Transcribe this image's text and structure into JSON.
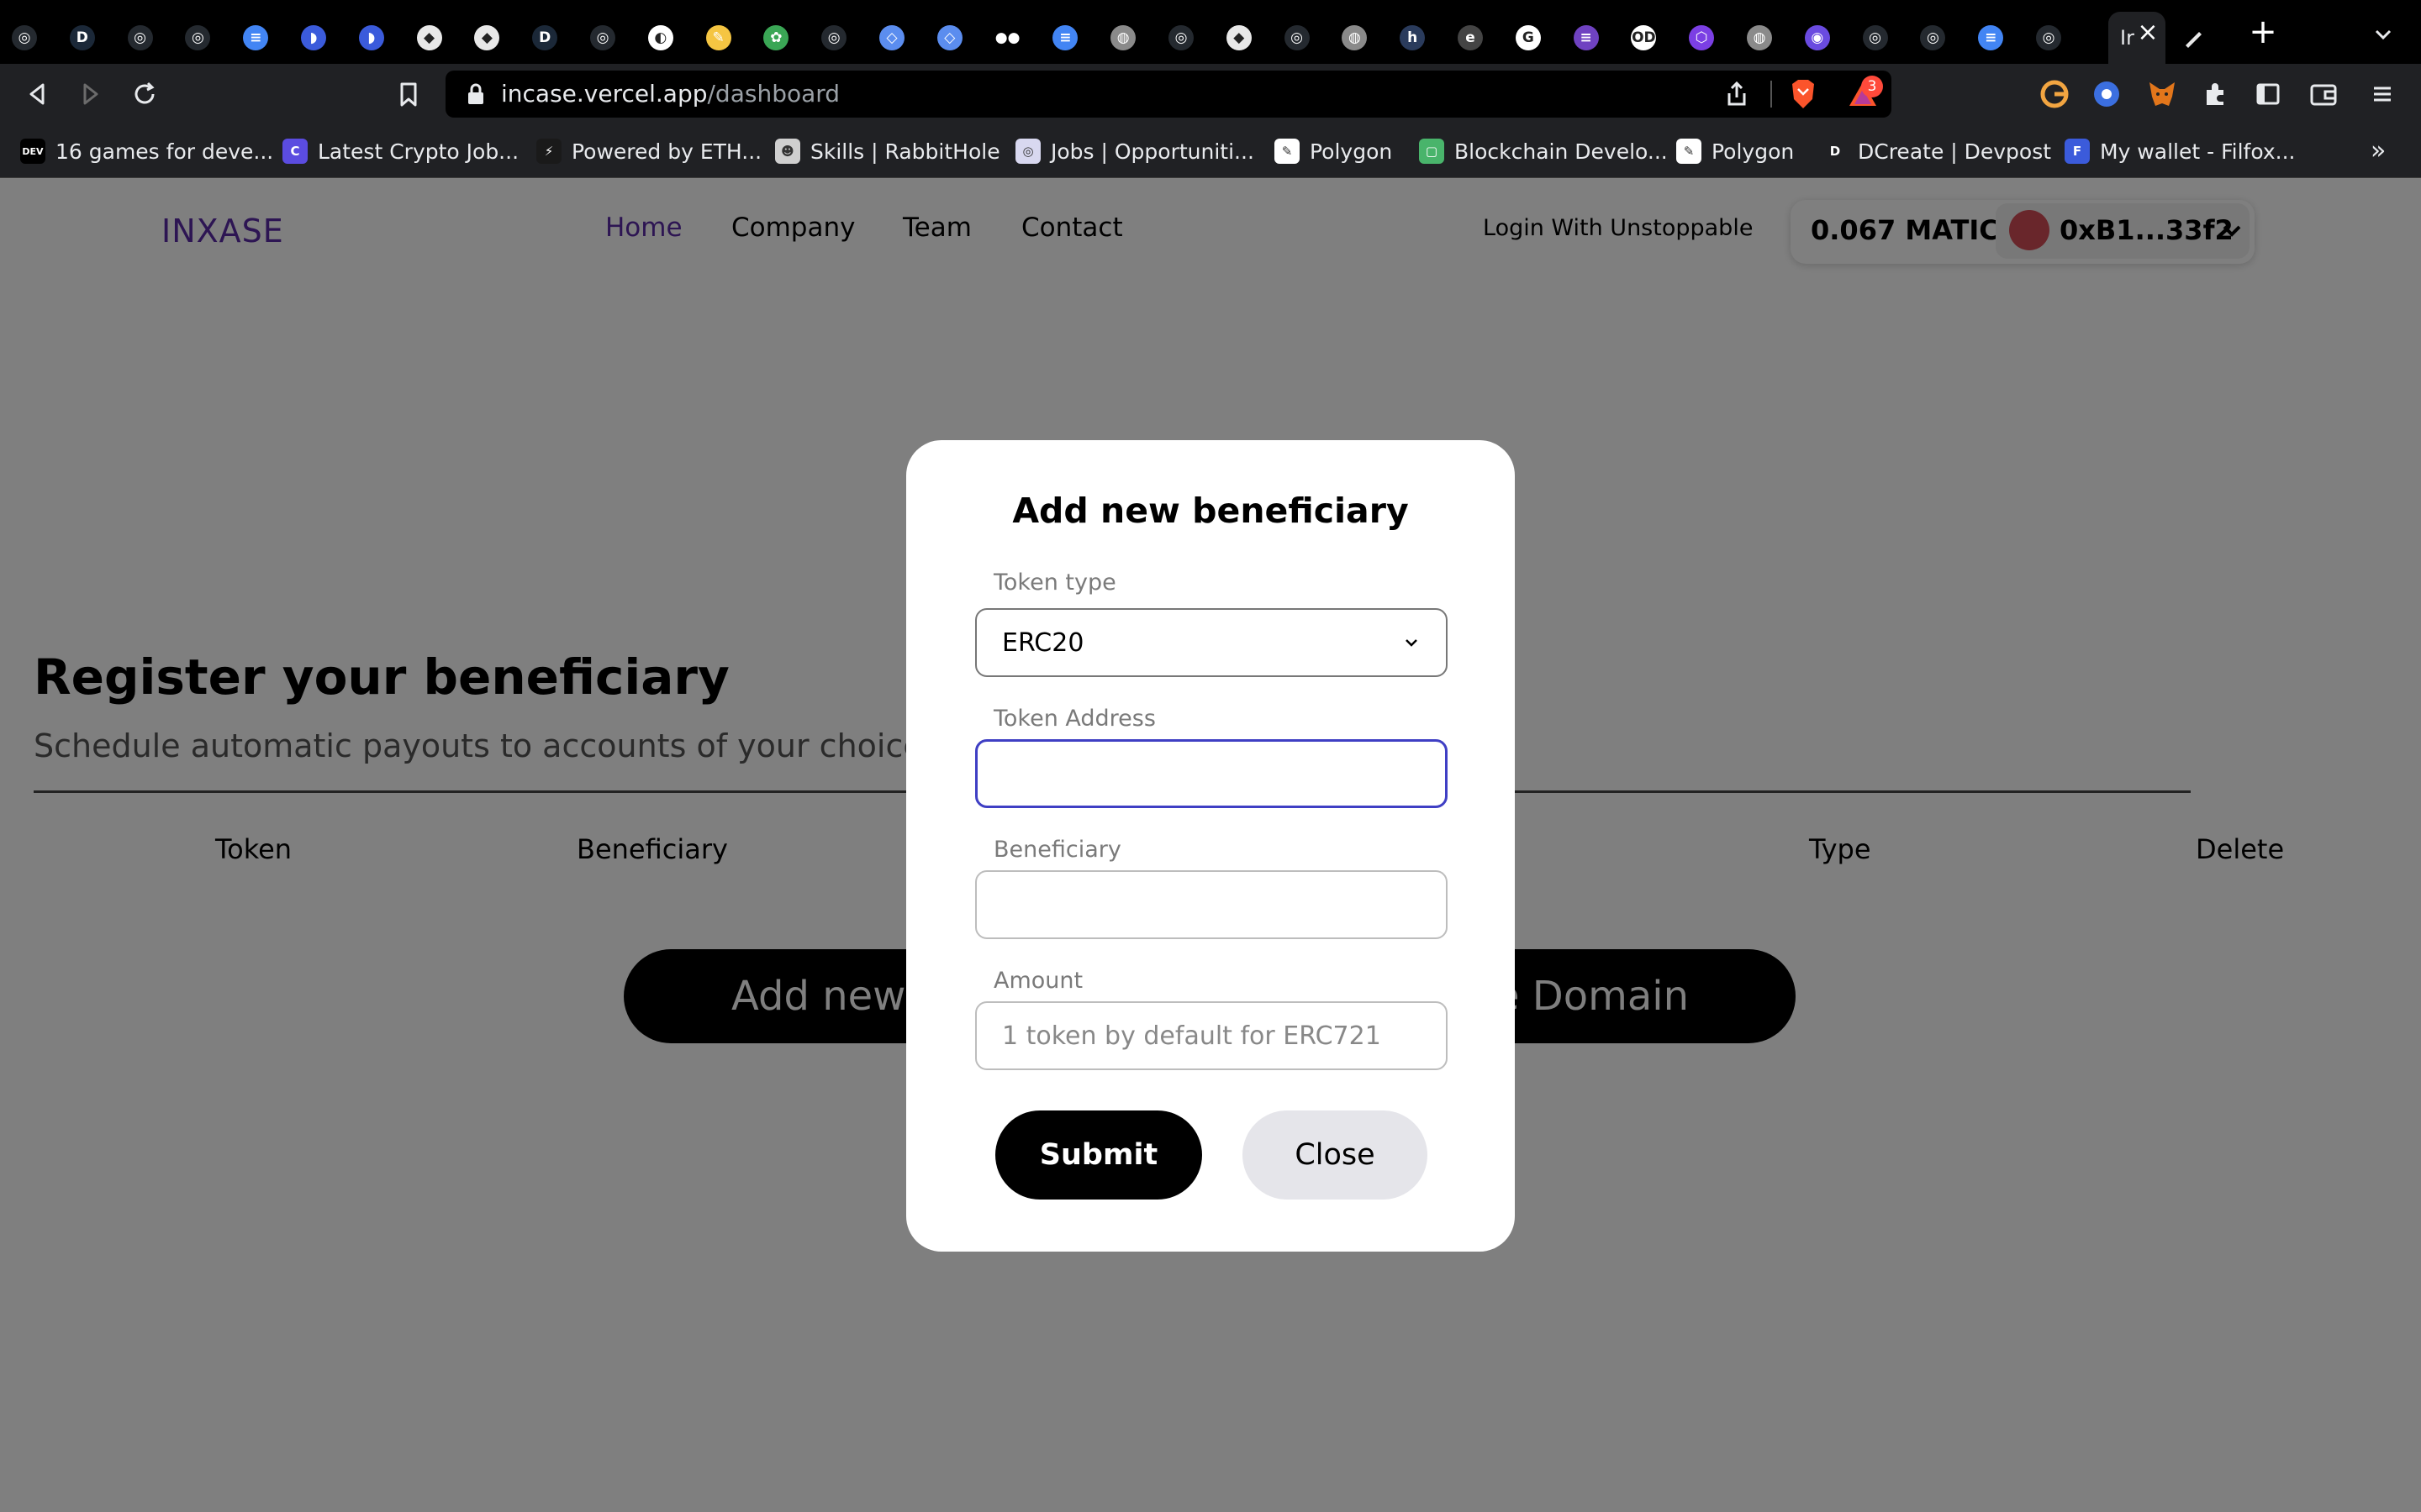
{
  "browser": {
    "tabs": [
      {
        "icon": "github-icon",
        "color": "#24292f",
        "glyph": "◎"
      },
      {
        "icon": "dev-icon",
        "color": "#1b2838",
        "glyph": "D"
      },
      {
        "icon": "github-icon",
        "color": "#24292f",
        "glyph": "◎"
      },
      {
        "icon": "github-icon",
        "color": "#24292f",
        "glyph": "◎"
      },
      {
        "icon": "docs-icon",
        "color": "#4285f4",
        "glyph": "≡"
      },
      {
        "icon": "bookmark-tab-icon",
        "color": "#3b5bdb",
        "glyph": "◗"
      },
      {
        "icon": "bookmark-tab-icon",
        "color": "#3b5bdb",
        "glyph": "◗"
      },
      {
        "icon": "ethereum-icon",
        "color": "#e8e8e8",
        "glyph": "◆"
      },
      {
        "icon": "ethereum-icon",
        "color": "#e8e8e8",
        "glyph": "◆"
      },
      {
        "icon": "dev-icon",
        "color": "#1b2838",
        "glyph": "D"
      },
      {
        "icon": "github-icon",
        "color": "#24292f",
        "glyph": "◎"
      },
      {
        "icon": "app-icon",
        "color": "#ffffff",
        "glyph": "◐"
      },
      {
        "icon": "notes-icon",
        "color": "#f5c542",
        "glyph": "✎"
      },
      {
        "icon": "leaf-icon",
        "color": "#3aa655",
        "glyph": "✿"
      },
      {
        "icon": "github-icon",
        "color": "#24292f",
        "glyph": "◎"
      },
      {
        "icon": "code-icon",
        "color": "#5b8def",
        "glyph": "◇"
      },
      {
        "icon": "code-icon",
        "color": "#5b8def",
        "glyph": "◇"
      },
      {
        "icon": "medium-icon",
        "color": "#000000",
        "glyph": "●●"
      },
      {
        "icon": "docs-icon",
        "color": "#4285f4",
        "glyph": "≡"
      },
      {
        "icon": "globe-icon",
        "color": "#8a8a8a",
        "glyph": "◍"
      },
      {
        "icon": "github-icon",
        "color": "#24292f",
        "glyph": "◎"
      },
      {
        "icon": "ethereum-icon",
        "color": "#e8e8e8",
        "glyph": "◆"
      },
      {
        "icon": "github-icon",
        "color": "#24292f",
        "glyph": "◎"
      },
      {
        "icon": "globe-icon",
        "color": "#8a8a8a",
        "glyph": "◍"
      },
      {
        "icon": "hashnode-icon",
        "color": "#2a3b5c",
        "glyph": "h"
      },
      {
        "icon": "app-icon",
        "color": "#444444",
        "glyph": "e"
      },
      {
        "icon": "google-icon",
        "color": "#ffffff",
        "glyph": "G"
      },
      {
        "icon": "list-icon",
        "color": "#6f42c1",
        "glyph": "≡"
      },
      {
        "icon": "od-icon",
        "color": "#ffffff",
        "glyph": "OD"
      },
      {
        "icon": "polygon-icon",
        "color": "#7b3fe4",
        "glyph": "⬡"
      },
      {
        "icon": "globe-icon",
        "color": "#8a8a8a",
        "glyph": "◍"
      },
      {
        "icon": "web3-icon",
        "color": "#6a4be0",
        "glyph": "◉"
      },
      {
        "icon": "github-icon",
        "color": "#24292f",
        "glyph": "◎"
      },
      {
        "icon": "github-icon",
        "color": "#24292f",
        "glyph": "◎"
      },
      {
        "icon": "docs-icon",
        "color": "#4285f4",
        "glyph": "≡"
      },
      {
        "icon": "github-icon",
        "color": "#24292f",
        "glyph": "◎"
      }
    ],
    "active_tab_label": "Ir",
    "close_tab_glyph": "×",
    "new_tab_glyph": "+",
    "url_host": "incase.vercel.app",
    "url_path": "/dashboard",
    "rewards_count": "3",
    "bookmarks": [
      {
        "label": "16 games for deve...",
        "icon": "dev-icon",
        "color": "#000000",
        "glyph": "DEV"
      },
      {
        "label": "Latest Crypto Job...",
        "icon": "crypto-jobs-icon",
        "color": "#5b4ce0",
        "glyph": "C"
      },
      {
        "label": "Powered by ETH...",
        "icon": "bolt-icon",
        "color": "#1a1a1a",
        "glyph": "⚡"
      },
      {
        "label": "Skills | RabbitHole",
        "icon": "rabbithole-icon",
        "color": "#cfcfcf",
        "glyph": "☻"
      },
      {
        "label": "Jobs | Opportuniti...",
        "icon": "jobs-icon",
        "color": "#d8d8f0",
        "glyph": "◎"
      },
      {
        "label": "Polygon",
        "icon": "pen-icon",
        "color": "#ffffff",
        "glyph": "✎"
      },
      {
        "label": "Blockchain Develo...",
        "icon": "blockchain-icon",
        "color": "#49b46b",
        "glyph": "▢"
      },
      {
        "label": "Polygon",
        "icon": "pen-icon",
        "color": "#ffffff",
        "glyph": "✎"
      },
      {
        "label": "DCreate | Devpost",
        "icon": "devpost-icon",
        "color": "#202124",
        "glyph": "D"
      },
      {
        "label": "My wallet - Filfox...",
        "icon": "filfox-icon",
        "color": "#3b5bdb",
        "glyph": "F"
      }
    ],
    "bookmarks_more_glyph": "»"
  },
  "header": {
    "logo": "INXASE",
    "nav": [
      "Home",
      "Company",
      "Team",
      "Contact"
    ],
    "login": "Login With Unstoppable",
    "balance": "0.067 MATIC",
    "address": "0xB1...33f2"
  },
  "hero": {
    "title": "Register your beneficiary",
    "subtitle": "Schedule automatic payouts to accounts of your choice a"
  },
  "table": {
    "headers": [
      "Token",
      "Beneficiary",
      "Type",
      "Delete"
    ]
  },
  "actions": {
    "add_new": "Add new b",
    "domain": "e Domain"
  },
  "modal": {
    "title": "Add new beneficiary",
    "token_type_label": "Token type",
    "token_type_value": "ERC20",
    "token_address_label": "Token Address",
    "token_address_value": "",
    "beneficiary_label": "Beneficiary",
    "beneficiary_value": "",
    "amount_label": "Amount",
    "amount_placeholder": "1 token by default for ERC721",
    "submit": "Submit",
    "close": "Close"
  },
  "colors": {
    "brand_purple": "#5b2aa6",
    "focus_blue": "#3f3fc4",
    "avatar_red": "#d24d57"
  }
}
